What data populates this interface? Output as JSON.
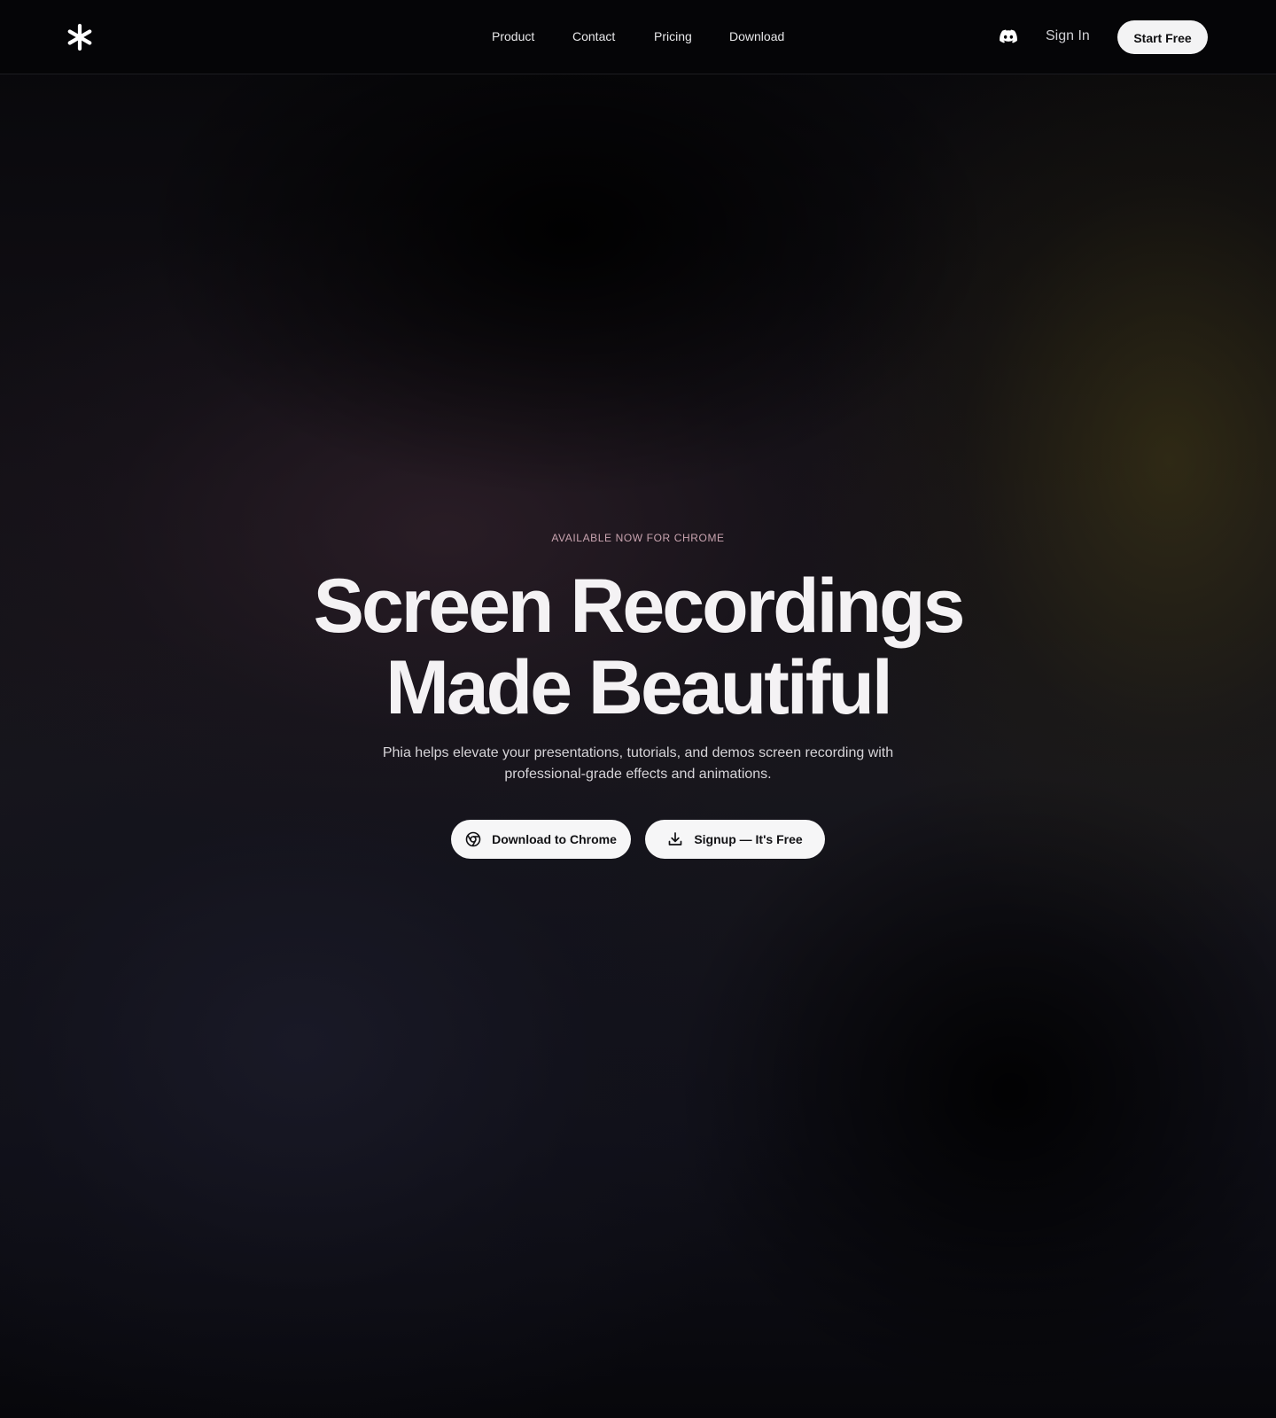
{
  "header": {
    "logo_icon": "asterisk-logo-icon",
    "nav": [
      {
        "label": "Product"
      },
      {
        "label": "Contact"
      },
      {
        "label": "Pricing"
      },
      {
        "label": "Download"
      }
    ],
    "discord_icon": "discord-icon",
    "signin_label": "Sign In",
    "start_free_label": "Start Free"
  },
  "hero": {
    "eyebrow": "AVAILABLE NOW FOR CHROME",
    "headline_line1": "Screen Recordings",
    "headline_line2": "Made Beautiful",
    "subtext": "Phia helps elevate your presentations, tutorials, and demos screen recording with professional-grade effects and animations.",
    "cta_chrome_label": "Download to Chrome",
    "cta_chrome_icon": "chrome-icon",
    "cta_signup_label": "Signup — It's Free",
    "cta_signup_icon": "download-icon"
  },
  "colors": {
    "background": "#050507",
    "eyebrow": "#c9a4b0",
    "button_bg": "#f6f6f7",
    "button_text": "#111114"
  }
}
